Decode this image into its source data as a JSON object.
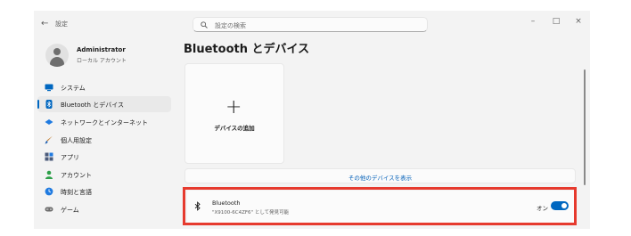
{
  "titlebar": {
    "back_glyph": "←",
    "app_title": "設定",
    "minimize_glyph": "–",
    "maximize_glyph": "□",
    "close_glyph": "×"
  },
  "search": {
    "placeholder": "設定の検索"
  },
  "user": {
    "name": "Administrator",
    "account_type": "ローカル アカウント"
  },
  "sidebar": {
    "items": [
      {
        "label": "システム",
        "icon": "monitor-icon",
        "color": "#0067c0"
      },
      {
        "label": "Bluetooth とデバイス",
        "icon": "bluetooth-icon",
        "color": "#0067c0",
        "active": true
      },
      {
        "label": "ネットワークとインターネット",
        "icon": "network-icon",
        "color": "#1f7ae0"
      },
      {
        "label": "個人用設定",
        "icon": "brush-icon",
        "color": "#c0792c"
      },
      {
        "label": "アプリ",
        "icon": "apps-icon",
        "color": "#4a5a7a"
      },
      {
        "label": "アカウント",
        "icon": "account-icon",
        "color": "#2ea04a"
      },
      {
        "label": "時刻と言語",
        "icon": "globe-clock-icon",
        "color": "#1f7ae0"
      },
      {
        "label": "ゲーム",
        "icon": "gamepad-icon",
        "color": "#6c6c6c"
      }
    ]
  },
  "main": {
    "title": "Bluetooth とデバイス",
    "add_device_label": "デバイスの追加",
    "add_device_glyph": "+",
    "show_more_label": "その他のデバイスを表示",
    "bluetooth_row": {
      "name": "Bluetooth",
      "description": "\"X9100-6C4ZF6\" として発見可能",
      "state": "オン",
      "enabled": true
    }
  },
  "colors": {
    "accent": "#0067c0",
    "highlight": "#e63a2e"
  }
}
